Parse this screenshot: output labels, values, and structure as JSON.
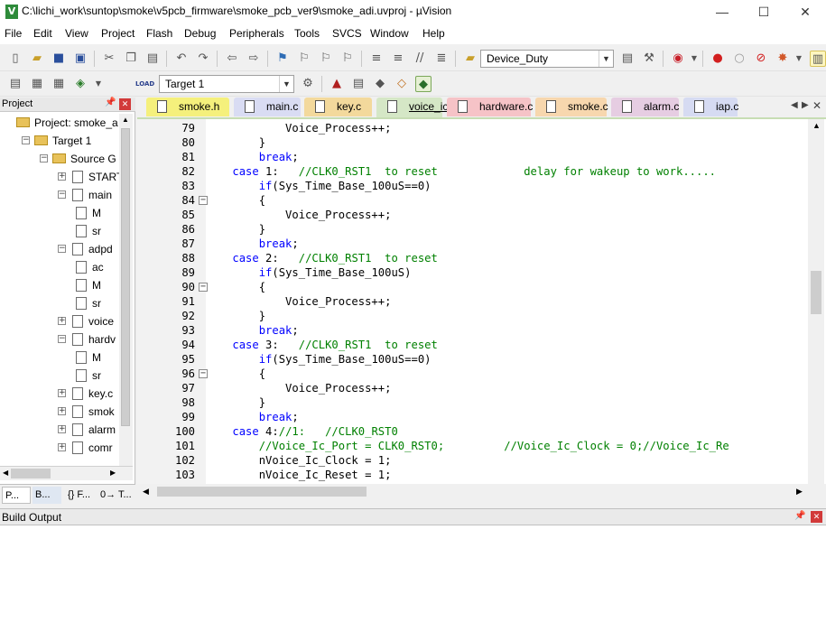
{
  "window": {
    "title": "C:\\lichi_work\\suntop\\smoke\\v5pcb_firmware\\smoke_pcb_ver9\\smoke_adi.uvproj - µVision",
    "app_icon": "V",
    "controls": [
      "—",
      "☐",
      "✕"
    ]
  },
  "menu": [
    "File",
    "Edit",
    "View",
    "Project",
    "Flash",
    "Debug",
    "Peripherals",
    "Tools",
    "SVCS",
    "Window",
    "Help"
  ],
  "toolbar1": {
    "target_combo": "Device_Duty"
  },
  "toolbar2": {
    "target_select": "Target 1"
  },
  "project": {
    "header": "Project",
    "tree": [
      {
        "label": "Project: smoke_a",
        "level": 0
      },
      {
        "label": "Target 1",
        "level": 1
      },
      {
        "label": "Source G",
        "level": 2
      },
      {
        "label": "START",
        "level": 3
      },
      {
        "label": "main",
        "level": 3
      },
      {
        "label": "M",
        "level": 4
      },
      {
        "label": "sr",
        "level": 4
      },
      {
        "label": "adpd",
        "level": 3
      },
      {
        "label": "ac",
        "level": 4
      },
      {
        "label": "M",
        "level": 4
      },
      {
        "label": "sr",
        "level": 4
      },
      {
        "label": "voice",
        "level": 3
      },
      {
        "label": "hardv",
        "level": 3
      },
      {
        "label": "M",
        "level": 4
      },
      {
        "label": "sr",
        "level": 4
      },
      {
        "label": "key.c",
        "level": 3
      },
      {
        "label": "smok",
        "level": 3
      },
      {
        "label": "alarm",
        "level": 3
      },
      {
        "label": "comr",
        "level": 3
      }
    ],
    "bottom_tabs": [
      "P...",
      "B...",
      "{} F...",
      "0→ T..."
    ]
  },
  "tabs": [
    {
      "label": "smoke.h",
      "color": "#f5f07c",
      "active": false
    },
    {
      "label": "main.c",
      "color": "#d9dcf3",
      "active": false
    },
    {
      "label": "key.c",
      "color": "#f3d99c",
      "active": false
    },
    {
      "label": "voice_ic.c",
      "color": "#d5e7c6",
      "active": true
    },
    {
      "label": "hardware.c",
      "color": "#f6c3c7",
      "active": false
    },
    {
      "label": "smoke.c",
      "color": "#f7d7ae",
      "active": false
    },
    {
      "label": "alarm.c",
      "color": "#e6cde2",
      "active": false
    },
    {
      "label": "iap.c",
      "color": "#d6dbf2",
      "active": false
    }
  ],
  "editor": {
    "lines": [
      {
        "n": "79",
        "fold": false,
        "segs": [
          {
            "t": "            Voice_Process++;",
            "c": ""
          }
        ]
      },
      {
        "n": "80",
        "fold": false,
        "segs": [
          {
            "t": "        }",
            "c": ""
          }
        ]
      },
      {
        "n": "81",
        "fold": false,
        "segs": [
          {
            "t": "        ",
            "c": ""
          },
          {
            "t": "break",
            "c": "kw"
          },
          {
            "t": ";",
            "c": ""
          }
        ]
      },
      {
        "n": "82",
        "fold": false,
        "segs": [
          {
            "t": "    ",
            "c": ""
          },
          {
            "t": "case",
            "c": "kw"
          },
          {
            "t": " 1:   ",
            "c": ""
          },
          {
            "t": "//CLK0_RST1  to reset             delay for wakeup to work.....",
            "c": "cm"
          }
        ]
      },
      {
        "n": "83",
        "fold": false,
        "segs": [
          {
            "t": "        ",
            "c": ""
          },
          {
            "t": "if",
            "c": "kw"
          },
          {
            "t": "(Sys_Time_Base_100uS==0)",
            "c": ""
          }
        ]
      },
      {
        "n": "84",
        "fold": true,
        "segs": [
          {
            "t": "        {",
            "c": ""
          }
        ]
      },
      {
        "n": "85",
        "fold": false,
        "segs": [
          {
            "t": "            Voice_Process++;",
            "c": ""
          }
        ]
      },
      {
        "n": "86",
        "fold": false,
        "segs": [
          {
            "t": "        }",
            "c": ""
          }
        ]
      },
      {
        "n": "87",
        "fold": false,
        "segs": [
          {
            "t": "        ",
            "c": ""
          },
          {
            "t": "break",
            "c": "kw"
          },
          {
            "t": ";",
            "c": ""
          }
        ]
      },
      {
        "n": "88",
        "fold": false,
        "segs": [
          {
            "t": "    ",
            "c": ""
          },
          {
            "t": "case",
            "c": "kw"
          },
          {
            "t": " 2:   ",
            "c": ""
          },
          {
            "t": "//CLK0_RST1  to reset",
            "c": "cm"
          }
        ]
      },
      {
        "n": "89",
        "fold": false,
        "segs": [
          {
            "t": "        ",
            "c": ""
          },
          {
            "t": "if",
            "c": "kw"
          },
          {
            "t": "(Sys_Time_Base_100uS)",
            "c": ""
          }
        ]
      },
      {
        "n": "90",
        "fold": true,
        "segs": [
          {
            "t": "        {",
            "c": ""
          }
        ]
      },
      {
        "n": "91",
        "fold": false,
        "segs": [
          {
            "t": "            Voice_Process++;",
            "c": ""
          }
        ]
      },
      {
        "n": "92",
        "fold": false,
        "segs": [
          {
            "t": "        }",
            "c": ""
          }
        ]
      },
      {
        "n": "93",
        "fold": false,
        "segs": [
          {
            "t": "        ",
            "c": ""
          },
          {
            "t": "break",
            "c": "kw"
          },
          {
            "t": ";",
            "c": ""
          }
        ]
      },
      {
        "n": "94",
        "fold": false,
        "segs": [
          {
            "t": "    ",
            "c": ""
          },
          {
            "t": "case",
            "c": "kw"
          },
          {
            "t": " 3:   ",
            "c": ""
          },
          {
            "t": "//CLK0_RST1  to reset",
            "c": "cm"
          }
        ]
      },
      {
        "n": "95",
        "fold": false,
        "segs": [
          {
            "t": "        ",
            "c": ""
          },
          {
            "t": "if",
            "c": "kw"
          },
          {
            "t": "(Sys_Time_Base_100uS==0)",
            "c": ""
          }
        ]
      },
      {
        "n": "96",
        "fold": true,
        "segs": [
          {
            "t": "        {",
            "c": ""
          }
        ]
      },
      {
        "n": "97",
        "fold": false,
        "segs": [
          {
            "t": "            Voice_Process++;",
            "c": ""
          }
        ]
      },
      {
        "n": "98",
        "fold": false,
        "segs": [
          {
            "t": "        }",
            "c": ""
          }
        ]
      },
      {
        "n": "99",
        "fold": false,
        "segs": [
          {
            "t": "        ",
            "c": ""
          },
          {
            "t": "break",
            "c": "kw"
          },
          {
            "t": ";",
            "c": ""
          }
        ]
      },
      {
        "n": "100",
        "fold": false,
        "segs": [
          {
            "t": "    ",
            "c": ""
          },
          {
            "t": "case",
            "c": "kw"
          },
          {
            "t": " 4:",
            "c": ""
          },
          {
            "t": "//1:   //CLK0_RST0",
            "c": "cm"
          }
        ]
      },
      {
        "n": "101",
        "fold": false,
        "segs": [
          {
            "t": "        ",
            "c": ""
          },
          {
            "t": "//Voice_Ic_Port = CLK0_RST0;         //Voice_Ic_Clock = 0;//Voice_Ic_Re",
            "c": "cm"
          }
        ]
      },
      {
        "n": "102",
        "fold": false,
        "segs": [
          {
            "t": "        nVoice_Ic_Clock = 1;",
            "c": ""
          }
        ]
      },
      {
        "n": "103",
        "fold": false,
        "segs": [
          {
            "t": "        nVoice_Ic_Reset = 1;",
            "c": ""
          }
        ]
      }
    ]
  },
  "build": {
    "header": "Build Output"
  }
}
